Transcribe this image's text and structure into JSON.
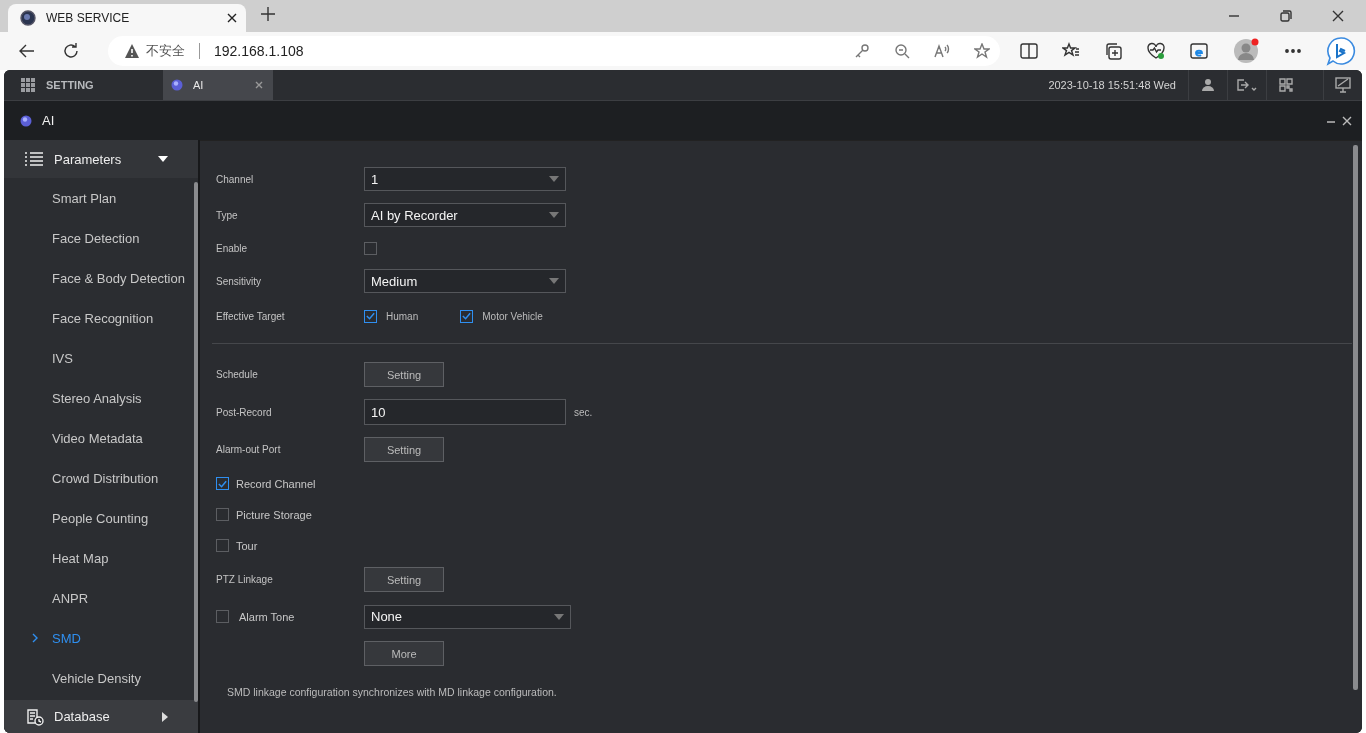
{
  "browser": {
    "tab_title": "WEB SERVICE",
    "security_label": "不安全",
    "url": "192.168.1.108"
  },
  "app": {
    "tabs": [
      {
        "label": "SETTING",
        "selected": false,
        "closable": false
      },
      {
        "label": "AI",
        "selected": true,
        "closable": true
      }
    ],
    "datetime": "2023-10-18 15:51:48 Wed"
  },
  "window": {
    "title": "AI"
  },
  "sidebar": {
    "groups": [
      {
        "label": "Parameters",
        "expanded": true,
        "items": [
          {
            "label": "Smart Plan",
            "selected": false
          },
          {
            "label": "Face Detection",
            "selected": false
          },
          {
            "label": "Face & Body Detection",
            "selected": false
          },
          {
            "label": "Face Recognition",
            "selected": false
          },
          {
            "label": "IVS",
            "selected": false
          },
          {
            "label": "Stereo Analysis",
            "selected": false
          },
          {
            "label": "Video Metadata",
            "selected": false
          },
          {
            "label": "Crowd Distribution",
            "selected": false
          },
          {
            "label": "People Counting",
            "selected": false
          },
          {
            "label": "Heat Map",
            "selected": false
          },
          {
            "label": "ANPR",
            "selected": false
          },
          {
            "label": "SMD",
            "selected": true
          },
          {
            "label": "Vehicle Density",
            "selected": false
          }
        ]
      },
      {
        "label": "Database",
        "expanded": false
      }
    ]
  },
  "form": {
    "rows": [
      {
        "kind": "select",
        "label": "Channel",
        "value": "1"
      },
      {
        "kind": "select",
        "label": "Type",
        "value": "AI by Recorder"
      },
      {
        "kind": "checkbox",
        "label": "Enable",
        "checked": false
      },
      {
        "kind": "select",
        "label": "Sensitivity",
        "value": "Medium"
      },
      {
        "kind": "options",
        "label": "Effective Target",
        "options": [
          {
            "label": "Human",
            "checked": true
          },
          {
            "label": "Motor Vehicle",
            "checked": true
          }
        ]
      },
      {
        "kind": "divider"
      },
      {
        "kind": "button",
        "label": "Schedule",
        "button": "Setting"
      },
      {
        "kind": "input",
        "label": "Post-Record",
        "value": "10",
        "unit": "sec."
      },
      {
        "kind": "button",
        "label": "Alarm-out Port",
        "button": "Setting"
      },
      {
        "kind": "check",
        "label": "Record Channel",
        "checked": true
      },
      {
        "kind": "check",
        "label": "Picture Storage",
        "checked": false
      },
      {
        "kind": "check",
        "label": "Tour",
        "checked": false
      },
      {
        "kind": "button",
        "label": "PTZ Linkage",
        "button": "Setting"
      },
      {
        "kind": "check_select",
        "label": "Alarm Tone",
        "checked": false,
        "value": "None"
      },
      {
        "kind": "button",
        "button": "More"
      },
      {
        "kind": "note",
        "text": "SMD linkage configuration synchronizes with MD linkage configuration."
      }
    ]
  }
}
